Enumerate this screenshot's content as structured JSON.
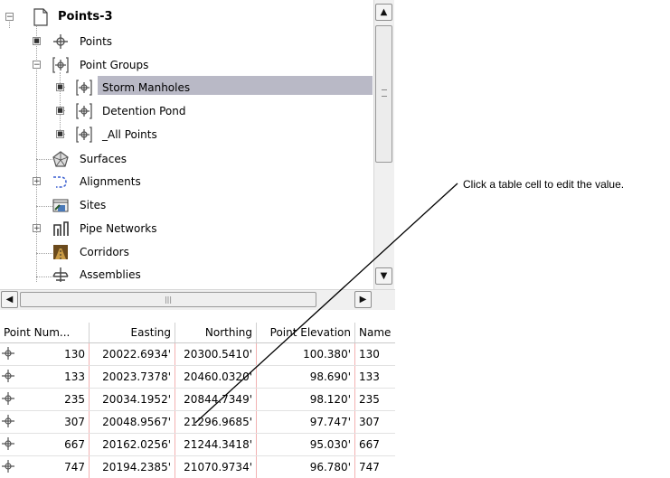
{
  "tree": {
    "items": [
      {
        "label": "Points-3",
        "expander": "minus",
        "icon": "drawing-page-icon",
        "bold": true
      },
      {
        "label": "Points",
        "expander": "dot",
        "icon": "point-icon"
      },
      {
        "label": "Point Groups",
        "expander": "minus",
        "icon": "point-group-icon"
      },
      {
        "label": "Storm Manholes",
        "expander": "dot",
        "icon": "point-group-icon",
        "selected": true
      },
      {
        "label": "Detention Pond",
        "expander": "dot",
        "icon": "point-group-icon"
      },
      {
        "label": "_All Points",
        "expander": "dot",
        "icon": "point-group-icon"
      },
      {
        "label": "Surfaces",
        "expander": "none",
        "icon": "surface-icon"
      },
      {
        "label": "Alignments",
        "expander": "plus",
        "icon": "alignment-icon"
      },
      {
        "label": "Sites",
        "expander": "none",
        "icon": "site-icon"
      },
      {
        "label": "Pipe Networks",
        "expander": "plus",
        "icon": "pipe-network-icon"
      },
      {
        "label": "Corridors",
        "expander": "none",
        "icon": "corridor-icon"
      },
      {
        "label": "Assemblies",
        "expander": "none",
        "icon": "assembly-icon"
      }
    ]
  },
  "table": {
    "columns": [
      "Point Num...",
      "Easting",
      "Northing",
      "Point Elevation",
      "Name"
    ],
    "rows": [
      [
        "130",
        "20022.6934'",
        "20300.5410'",
        "100.380'",
        "130"
      ],
      [
        "133",
        "20023.7378'",
        "20460.0320'",
        "98.690'",
        "133"
      ],
      [
        "235",
        "20034.1952'",
        "20844.7349'",
        "98.120'",
        "235"
      ],
      [
        "307",
        "20048.9567'",
        "21296.9685'",
        "97.747'",
        "307"
      ],
      [
        "667",
        "20162.0256'",
        "21244.3418'",
        "95.030'",
        "667"
      ],
      [
        "747",
        "20194.2385'",
        "21070.9734'",
        "96.780'",
        "747"
      ]
    ]
  },
  "callout": {
    "text": "Click a table cell to edit the value."
  },
  "colors": {
    "selection": "#b9b9c6",
    "grid_line": "#f2b2b2"
  }
}
